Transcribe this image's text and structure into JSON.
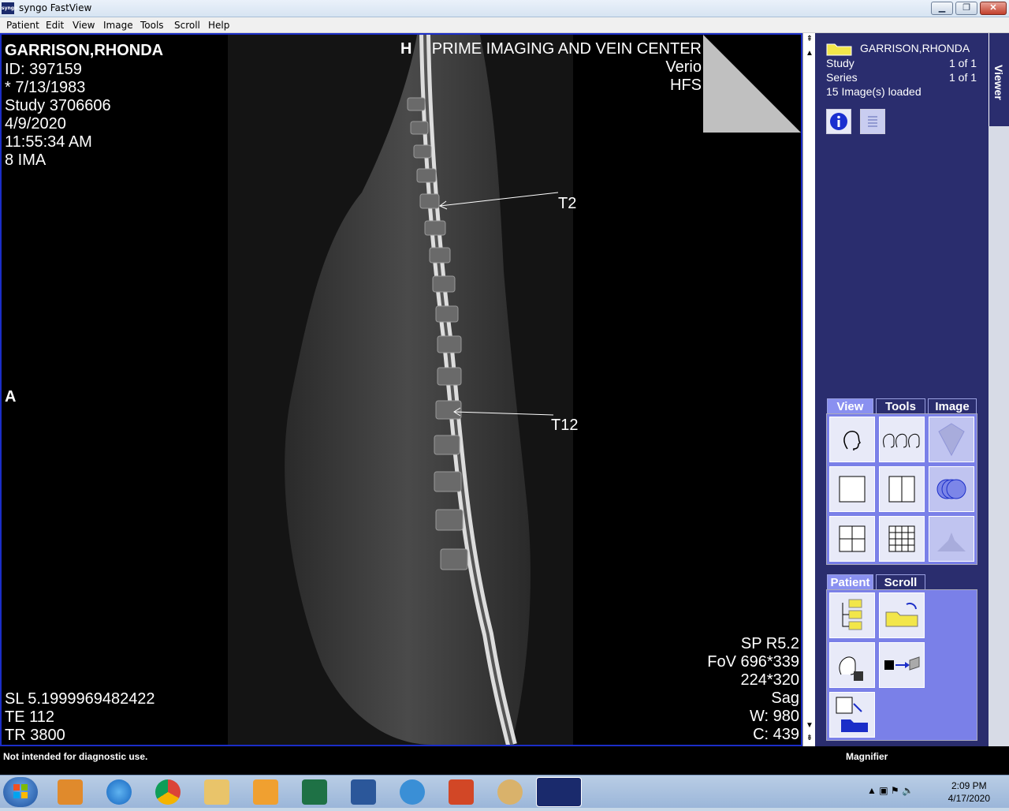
{
  "window": {
    "title": "syngo FastView",
    "app_icon_text": "syngo"
  },
  "menu": [
    "Patient",
    "Edit",
    "View",
    "Image",
    "Tools",
    "Scroll",
    "Help"
  ],
  "overlay": {
    "patient_name": "GARRISON,RHONDA",
    "id": "ID: 397159",
    "dob": "* 7/13/1983",
    "study": "Study 3706606",
    "date": "4/9/2020",
    "time": "11:55:34 AM",
    "ima": "8 IMA",
    "orientation_top": "H",
    "orientation_left": "A",
    "institution": "PRIME IMAGING AND VEIN CENTER",
    "scanner": "Verio",
    "position": "HFS",
    "label_t2": "T2",
    "label_t12": "T12",
    "sl": "SL 5.1999969482422",
    "te": "TE 112",
    "tr": "TR 3800",
    "sp": "SP R5.2",
    "fov": "FoV 696*339",
    "matrix": "224*320",
    "plane": "Sag",
    "window_w": "W: 980",
    "window_c": "C: 439"
  },
  "panel": {
    "patient_name": "GARRISON,RHONDA",
    "study_label": "Study",
    "study_value": "1 of 1",
    "series_label": "Series",
    "series_value": "1 of 1",
    "images_loaded": "15 Image(s) loaded",
    "side_tab": "Viewer",
    "tabs_top": [
      "View",
      "Tools",
      "Image"
    ],
    "tabs_bottom": [
      "Patient",
      "Scroll"
    ]
  },
  "status": {
    "left": "Not intended for diagnostic use.",
    "right": "Magnifier"
  },
  "taskbar": {
    "time": "2:09 PM",
    "date": "4/17/2020"
  }
}
